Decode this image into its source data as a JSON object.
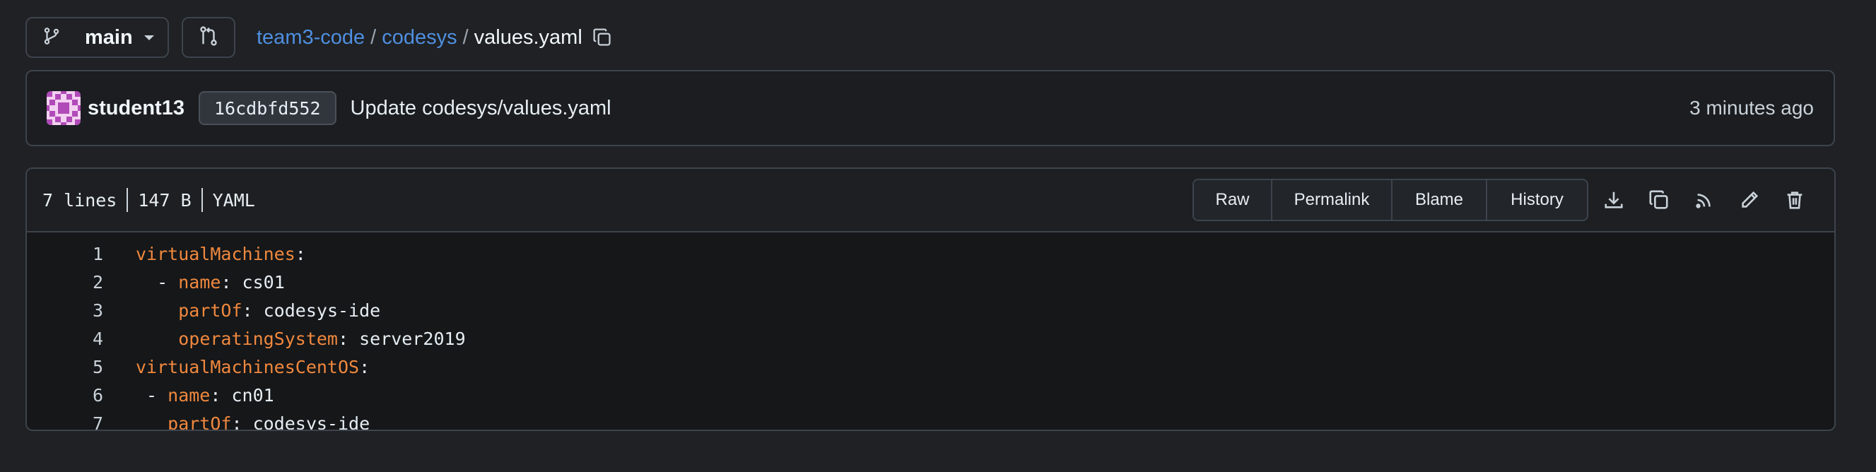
{
  "branch": {
    "name": "main"
  },
  "breadcrumb": {
    "owner": "team3-code",
    "folder": "codesys",
    "file": "values.yaml",
    "separator": "/"
  },
  "commit": {
    "author": "student13",
    "sha": "16cdbfd552",
    "message": "Update codesys/values.yaml",
    "time": "3 minutes ago"
  },
  "file_header": {
    "lines": "7 lines",
    "size": "147 B",
    "language": "YAML",
    "buttons": {
      "raw": "Raw",
      "permalink": "Permalink",
      "blame": "Blame",
      "history": "History"
    },
    "icons": [
      "download-icon",
      "copy-icon",
      "symbols-icon",
      "pencil-icon",
      "trash-icon"
    ]
  },
  "code_lines": [
    {
      "num": "1",
      "indent": "",
      "key": "virtualMachines",
      "rest": ":"
    },
    {
      "num": "2",
      "indent": "  - ",
      "key": "name",
      "rest": ": cs01"
    },
    {
      "num": "3",
      "indent": "    ",
      "key": "partOf",
      "rest": ": codesys-ide"
    },
    {
      "num": "4",
      "indent": "    ",
      "key": "operatingSystem",
      "rest": ": server2019"
    },
    {
      "num": "5",
      "indent": "",
      "key": "virtualMachinesCentOS",
      "rest": ":"
    },
    {
      "num": "6",
      "indent": " - ",
      "key": "name",
      "rest": ": cn01"
    },
    {
      "num": "7",
      "indent": "   ",
      "key": "partOf",
      "rest": ": codesys-ide"
    }
  ],
  "colors": {
    "accent_link": "#4f8fe0",
    "yaml_key": "#f0883e",
    "background": "#1f2124"
  }
}
